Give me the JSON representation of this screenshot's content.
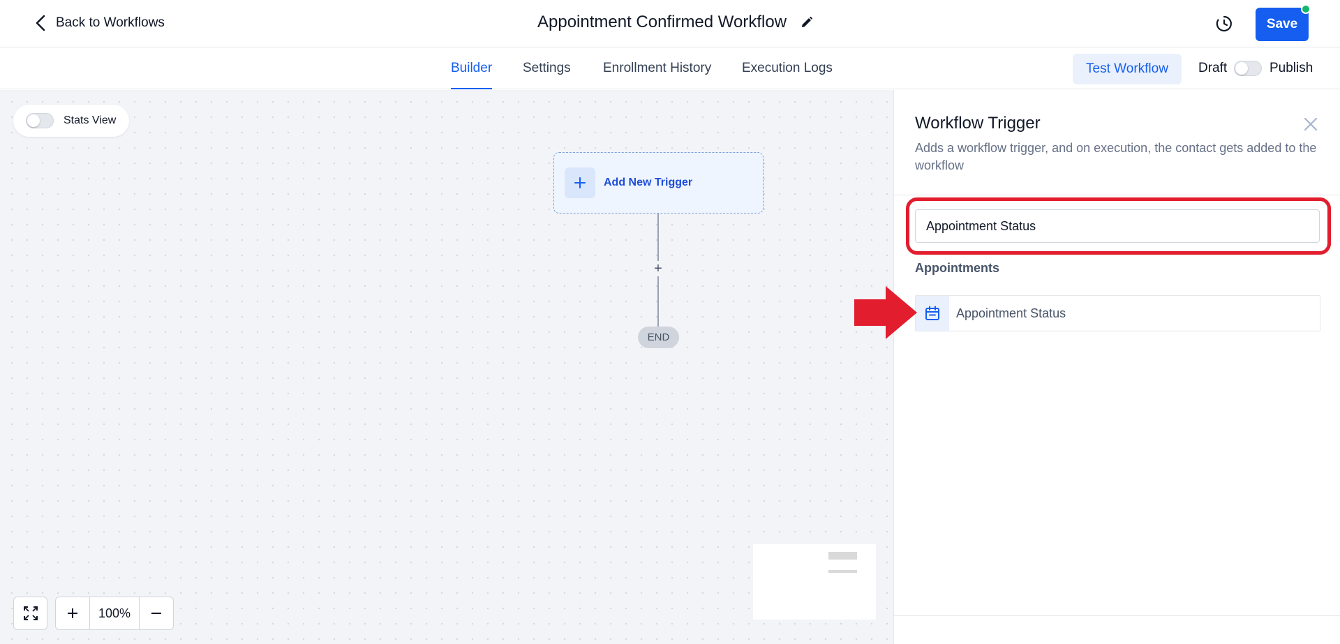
{
  "header": {
    "back_label": "Back to Workflows",
    "workflow_title": "Appointment Confirmed Workflow",
    "save_label": "Save",
    "status_dot_color": "#12b76a"
  },
  "tabs": [
    {
      "label": "Builder",
      "active": true
    },
    {
      "label": "Settings",
      "active": false
    },
    {
      "label": "Enrollment History",
      "active": false
    },
    {
      "label": "Execution Logs",
      "active": false
    }
  ],
  "toolbar": {
    "test_label": "Test Workflow",
    "draft_label": "Draft",
    "publish_label": "Publish",
    "published": false
  },
  "canvas": {
    "stats_view_label": "Stats View",
    "stats_view_on": false,
    "trigger_label": "Add New Trigger",
    "end_label": "END",
    "zoom_level": "100%"
  },
  "panel": {
    "title": "Workflow Trigger",
    "description": "Adds a workflow trigger, and on execution, the contact gets added to the workflow",
    "search_value": "Appointment Status",
    "group_heading": "Appointments",
    "options": [
      {
        "label": "Appointment Status",
        "icon": "calendar-icon"
      }
    ]
  },
  "colors": {
    "accent": "#155eef",
    "annotation_red": "#e11d2e"
  }
}
